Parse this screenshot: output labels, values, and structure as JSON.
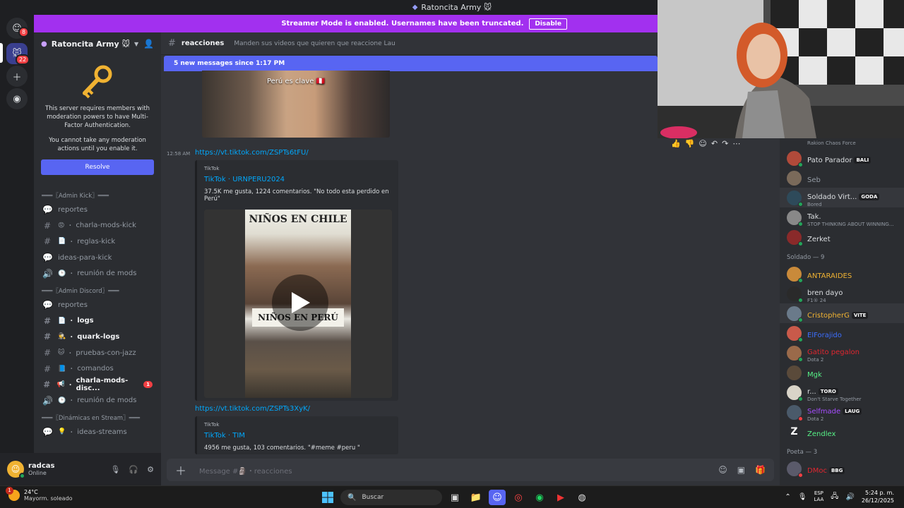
{
  "window": {
    "title": "Ratoncita Army 🐭"
  },
  "rail": {
    "home_badge": "8",
    "server_badge": "22"
  },
  "streamer_banner": {
    "text": "Streamer Mode is enabled. Usernames have been truncated.",
    "button": "Disable"
  },
  "guild": {
    "name": "Ratoncita Army 🐭",
    "mfa_text_1": "This server requires members with moderation powers to have Multi-Factor Authentication.",
    "mfa_text_2": "You cannot take any moderation actions until you enable it.",
    "resolve": "Resolve"
  },
  "channels": {
    "cat_kick": "═══〖Admin Kick〗═══",
    "reportes_kick": "reportes",
    "charla_mods_kick": "charla-mods-kick",
    "reglas_kick": "reglas-kick",
    "ideas_para_kick": "ideas-para-kick",
    "reunion_kick": "reunión de mods",
    "cat_discord": "═══〖Admin Discord〗═══",
    "reportes_discord": "reportes",
    "logs": "logs",
    "quark_logs": "quark-logs",
    "pruebas": "pruebas-con-jazz",
    "comandos": "comandos",
    "charla_disc": "charla-mods-disc...",
    "charla_disc_mentions": "1",
    "reunion_discord": "reunión de mods",
    "cat_dinamicas": "═══〖Dinámicas en Stream〗═══",
    "ideas_streams": "ideas-streams"
  },
  "user": {
    "name": "radcas",
    "status": "Online"
  },
  "chat": {
    "channel_name": "reacciones",
    "topic": "Manden sus videos que quieren que reaccione Lau",
    "new_messages": "5 new messages since 1:17 PM",
    "caption_top": "Perú es clave 🇵🇪",
    "message_time": "12:58 AM",
    "link_1": "https://vt.tiktok.com/ZSPTs6tFU/",
    "embed_1": {
      "provider": "TikTok",
      "title": "TikTok · URNPERU2024",
      "desc": "37.5K me gusta, 1224 comentarios. \"No todo esta perdido en Perú\"",
      "video_caption_1": "NIÑOS EN CHILE",
      "video_caption_2": "NIÑOS EN PERÚ"
    },
    "link_2": "https://vt.tiktok.com/ZSPTs3XyK/",
    "embed_2": {
      "provider": "TikTok",
      "title": "TikTok · TIM",
      "desc": "4956 me gusta, 103 comentarios. \"#meme #peru \""
    },
    "composer_placeholder": "Message #🗿・reacciones"
  },
  "members": {
    "m0_activity": "Rakion Chaos Force",
    "m1_name": "Pato Parador",
    "m1_tag": "BALI",
    "m2_name": "Seb",
    "m3_name": "Soldado Virt...",
    "m3_tag": "GODA",
    "m3_activity": "Bored",
    "m4_name": "Tak.",
    "m4_activity": "STOP THINKING ABOUT WINNING...",
    "m5_name": "Zerket",
    "role_soldado": "Soldado — 9",
    "s1_name": "ANTARAIDES",
    "s2_name": "bren dayo",
    "s2_activity": "F1® 24",
    "s3_name": "CristopherG",
    "s3_tag": "VITE",
    "s4_name": "ElForajido",
    "s5_name": "Gatito pegalon",
    "s5_activity": "Dota 2",
    "s6_name": "Mgk",
    "s7_name": "r...",
    "s7_tag": "TORO",
    "s7_activity": "Don't Starve Together",
    "s8_name": "Selfmade",
    "s8_tag": "LAUG",
    "s8_activity": "Dota 2",
    "s9_name": "Zendlex",
    "role_poeta": "Poeta — 3",
    "p1_name": "DMoc",
    "p1_tag": "BBG"
  },
  "taskbar": {
    "weather_badge": "1",
    "temperature": "24°C",
    "weather": "Mayorm. soleado",
    "search_placeholder": "Buscar",
    "lang_1": "ESP",
    "lang_2": "LAA",
    "time": "5:24 p. m.",
    "date": "26/12/2025"
  },
  "colors": {
    "blurple": "#5865f2",
    "streamer": "#a230ef",
    "link": "#00a8fc",
    "online": "#23a55a",
    "dnd": "#f23f43"
  }
}
